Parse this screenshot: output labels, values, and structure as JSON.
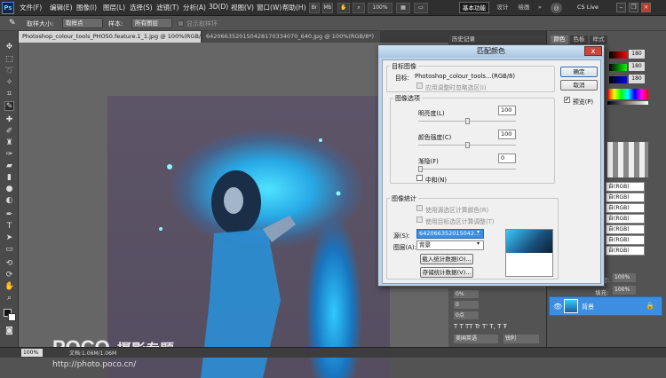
{
  "menubar": {
    "logo": "Ps",
    "items": [
      "文件(F)",
      "编辑(E)",
      "图像(I)",
      "图层(L)",
      "选择(S)",
      "滤镜(T)",
      "分析(A)",
      "3D(D)",
      "视图(V)",
      "窗口(W)",
      "帮助(H)"
    ],
    "zoom": "100%",
    "workspace": [
      "基本功能",
      "设计",
      "绘画"
    ],
    "cslive": "CS Live"
  },
  "options": {
    "sample_size_label": "取样大小:",
    "sample_size": "取样点",
    "sample_label": "样本:",
    "sample": "所有图层",
    "show_ring": "显示取样环"
  },
  "tabs": [
    "Photoshop_colour_tools_PHO50.feature.1_1.jpg @ 100%(RGB/8*)",
    "6420663520150428170334070_640.jpg @ 100%(RGB/8*)"
  ],
  "watermark": {
    "brand": "POCO",
    "title": "摄影专题",
    "url": "http://photo.poco.cn/"
  },
  "status": {
    "zoom": "100%",
    "doc": "文档:1.06M/1.06M"
  },
  "right_panel": {
    "history": "历史记录",
    "swatch_tabs": [
      "颜色",
      "色板",
      "样式"
    ],
    "color_values": [
      "180",
      "180",
      "180"
    ],
    "name_items": [
      "自(RGB)",
      "自(RGB)",
      "自(RGB)",
      "自(RGB)",
      "自(RGB)",
      "自(RGB)",
      "自(RGB)"
    ],
    "opacity_label": "不透明度:",
    "opacity": "100%",
    "fill_label": "填充:",
    "fill": "100%",
    "layer_name": "背景",
    "char": {
      "pct": "0%",
      "zero": "0",
      "pt": "0点",
      "lang": "美国英语",
      "aa": "锐利"
    }
  },
  "dialog": {
    "title": "匹配颜色",
    "close": "x",
    "dest_legend": "目标图像",
    "target_label": "目标:",
    "target_value": "Photoshop_colour_tools...(RGB/8)",
    "ignore_sel": "应用调整时忽略选区(I)",
    "opts_legend": "图像选项",
    "luminance_label": "明亮度(L)",
    "luminance": "100",
    "intensity_label": "颜色强度(C)",
    "intensity": "100",
    "fade_label": "渐隐(F)",
    "fade": "0",
    "neutralize": "中和(N)",
    "stats_legend": "图像统计",
    "use_sel_source": "使用源选区计算颜色(R)",
    "use_sel_target": "使用目标选区计算调整(T)",
    "source_label": "源(S):",
    "source_value": "642066352015042...",
    "layer_label": "图层(A):",
    "layer_value": "背景",
    "load_btn": "载入统计数据(O)...",
    "save_btn": "存储统计数据(V)...",
    "ok": "确定",
    "cancel": "取消",
    "preview": "预览(P)",
    "preview_check": "✔"
  },
  "colors": {
    "accent": "#1f8fff",
    "selection": "#3d8ee0",
    "cyan": "#2ec5ff"
  }
}
